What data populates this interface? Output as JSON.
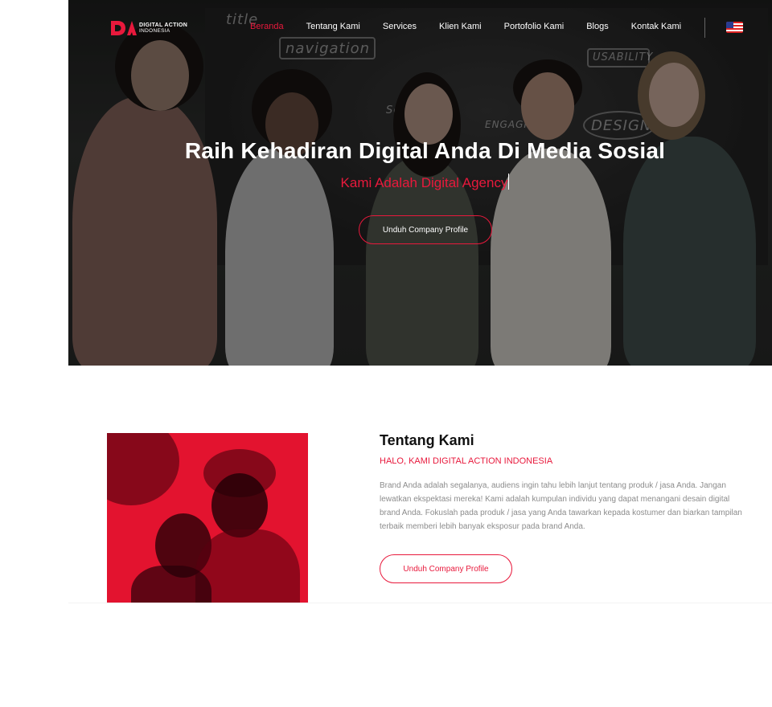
{
  "brand": {
    "name_line1": "DIGITAL ACTION",
    "name_line2": "INDONESIA",
    "accent_color": "#e8193c"
  },
  "nav": {
    "items": [
      {
        "label": "Beranda",
        "active": true
      },
      {
        "label": "Tentang Kami",
        "active": false
      },
      {
        "label": "Services",
        "active": false
      },
      {
        "label": "Klien Kami",
        "active": false
      },
      {
        "label": "Portofolio Kami",
        "active": false
      },
      {
        "label": "Blogs",
        "active": false
      },
      {
        "label": "Kontak Kami",
        "active": false
      }
    ],
    "language_icon": "us-flag-icon"
  },
  "hero": {
    "title": "Raih Kehadiran Digital Anda Di Media Sosial",
    "subtitle": "Kami Adalah Digital Agency",
    "button_label": "Unduh Company Profile",
    "chalk_words": [
      "title",
      "navigation",
      "Services",
      "USABILITY",
      "ENGAGING",
      "DESIGN"
    ]
  },
  "about": {
    "title": "Tentang Kami",
    "subtitle": "HALO, KAMI DIGITAL ACTION INDONESIA",
    "body": "Brand Anda adalah segalanya, audiens ingin tahu lebih lanjut tentang produk / jasa Anda. Jangan lewatkan ekspektasi mereka! Kami adalah kumpulan individu yang dapat menangani desain digital brand Anda. Fokuslah pada produk / jasa yang Anda tawarkan kepada kostumer dan biarkan tampilan terbaik memberi lebih banyak eksposur pada brand Anda.",
    "button_label": "Unduh Company Profile"
  }
}
